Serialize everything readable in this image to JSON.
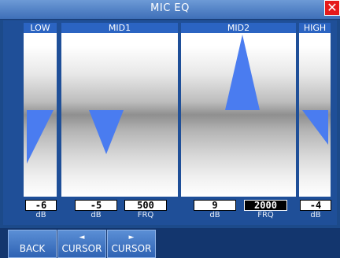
{
  "window": {
    "title": "MIC EQ",
    "close_icon": "close-icon"
  },
  "bands": [
    {
      "id": "low",
      "name": "LOW",
      "db": "-6",
      "db_unit": "dB"
    },
    {
      "id": "mid1",
      "name": "MID1",
      "db": "-5",
      "db_unit": "dB",
      "freq": "500",
      "freq_unit": "FRQ"
    },
    {
      "id": "mid2",
      "name": "MID2",
      "db": "9",
      "db_unit": "dB",
      "freq": "2000",
      "freq_unit": "FRQ"
    },
    {
      "id": "high",
      "name": "HIGH",
      "db": "-4",
      "db_unit": "dB"
    }
  ],
  "selected_field": "mid2.freq",
  "buttons": {
    "back": "BACK",
    "cursor_left": "CURSOR",
    "cursor_right": "CURSOR",
    "left_arrow_icon": "◄",
    "right_arrow_icon": "►"
  },
  "colors": {
    "accent": "#2b64c2",
    "curve": "#4a7cf0",
    "close": "#e51a1a"
  }
}
